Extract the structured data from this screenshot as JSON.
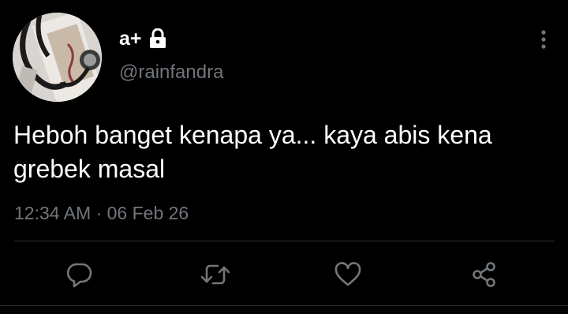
{
  "tweet": {
    "display_name": "a+",
    "handle": "@rainfandra",
    "text": "Heboh banget kenapa ya... kaya abis kena grebek masal",
    "time": "12:34 AM",
    "separator": "·",
    "date": "06 Feb 26",
    "protected": true
  },
  "icons": {
    "lock": "lock-icon",
    "more": "more-vertical-icon",
    "reply": "reply-icon",
    "retweet": "retweet-icon",
    "like": "heart-icon",
    "share": "share-icon"
  },
  "colors": {
    "background": "#000000",
    "primary_text": "#ffffff",
    "secondary_text": "#71767b",
    "divider": "#2f3336"
  }
}
